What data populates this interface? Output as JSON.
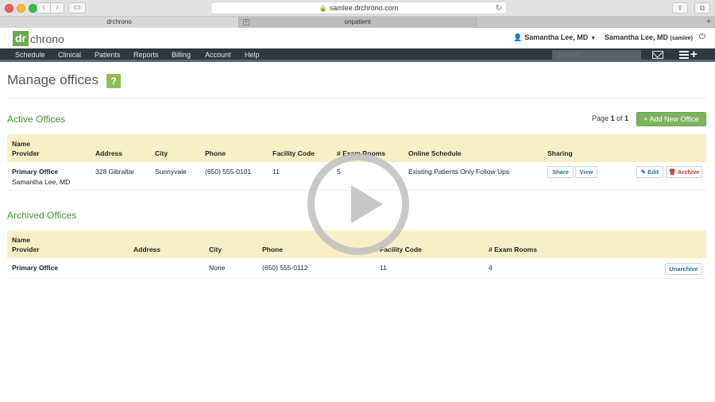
{
  "browser": {
    "url": "samlee.drchrono.com",
    "tabs": [
      "drchrono",
      "onpatient"
    ]
  },
  "header": {
    "logo_dr": "dr",
    "logo_chrono": "chrono",
    "user_menu": "Samantha Lee, MD",
    "user_name": "Samantha Lee, MD",
    "user_handle": "(samlee)"
  },
  "nav": {
    "items": [
      "Schedule",
      "Clinical",
      "Patients",
      "Reports",
      "Billing",
      "Account",
      "Help"
    ],
    "search_placeholder": "Search"
  },
  "page": {
    "title": "Manage offices",
    "help": "?"
  },
  "active": {
    "title": "Active Offices",
    "pager_prefix": "Page ",
    "pager_current": "1",
    "pager_mid": " of ",
    "pager_total": "1",
    "add_button": "+ Add New Office",
    "headers": {
      "name": "Name",
      "provider": "Provider",
      "address": "Address",
      "city": "City",
      "phone": "Phone",
      "facility_code": "Facility Code",
      "exam_rooms": "# Exam Rooms",
      "online_schedule": "Online Schedule",
      "sharing": "Sharing"
    },
    "row": {
      "name": "Primary Office",
      "provider": "Samantha Lee, MD",
      "address": "328 Gibraltar",
      "city": "Sunnyvale",
      "phone": "(650) 555-0101",
      "facility_code": "11",
      "exam_rooms": "5",
      "online_schedule": "Existing Patients Only Follow Ups",
      "share": "Share",
      "view": "View",
      "edit": "✎ Edit",
      "archive": "🗑 Archive"
    }
  },
  "archived": {
    "title": "Archived Offices",
    "headers": {
      "name": "Name",
      "provider": "Provider",
      "address": "Address",
      "city": "City",
      "phone": "Phone",
      "facility_code": "Facility Code",
      "exam_rooms": "# Exam Rooms"
    },
    "row": {
      "name": "Primary Office",
      "city": "None",
      "phone": "(650) 555-0112",
      "facility_code": "11",
      "exam_rooms": "4",
      "unarchive": "Unarchive"
    }
  },
  "colors": {
    "brand_green": "#6aa84f",
    "nav_bg": "#2f3740",
    "header_row": "#f9efc7",
    "section_title": "#4c8a3a"
  }
}
